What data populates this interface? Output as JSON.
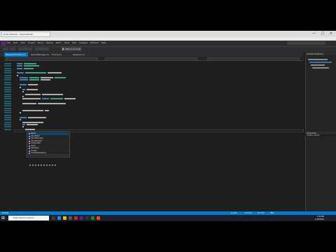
{
  "browser": {
    "tab_title": "Unity Tutorial - Visual Studio"
  },
  "vs": {
    "menu": [
      "File",
      "Edit",
      "View",
      "Project",
      "Build",
      "Debug",
      "Team",
      "Tools",
      "Test",
      "Analyze",
      "Window",
      "Help"
    ],
    "run_label": "Attach to Unity",
    "doc_tabs": [
      "PlayerController.cs",
      "GameManager.cs",
      "Enemy.cs",
      "Spawner.cs"
    ],
    "panel_solution": "Solution Explorer",
    "panel_properties": "Properties",
    "tree": [
      "Solution 'Game'",
      "Assembly-CSharp",
      "Assets",
      "Scripts"
    ],
    "status_left": "Ready",
    "status_right": [
      "Ln 42",
      "Col 13",
      "Ch 13",
      "INS"
    ]
  },
  "intellisense": {
    "items": [
      "Input",
      "InputField",
      "InputManager",
      "InputSystem",
      "Instantiate",
      "Int32",
      "Interface",
      "Invoke",
      "InvokeRepeating",
      "IsInvoking"
    ],
    "selected_index": 0
  },
  "taskbar": {
    "search_placeholder": "Type here to search",
    "time": "3:42 PM",
    "date": "1/15/2019"
  },
  "colors": {
    "accent": "#007acc",
    "keyword": "#569cd6",
    "type": "#4ec9b0",
    "string": "#d69d85",
    "comment": "#57a64a",
    "text": "#dcdcdc"
  }
}
